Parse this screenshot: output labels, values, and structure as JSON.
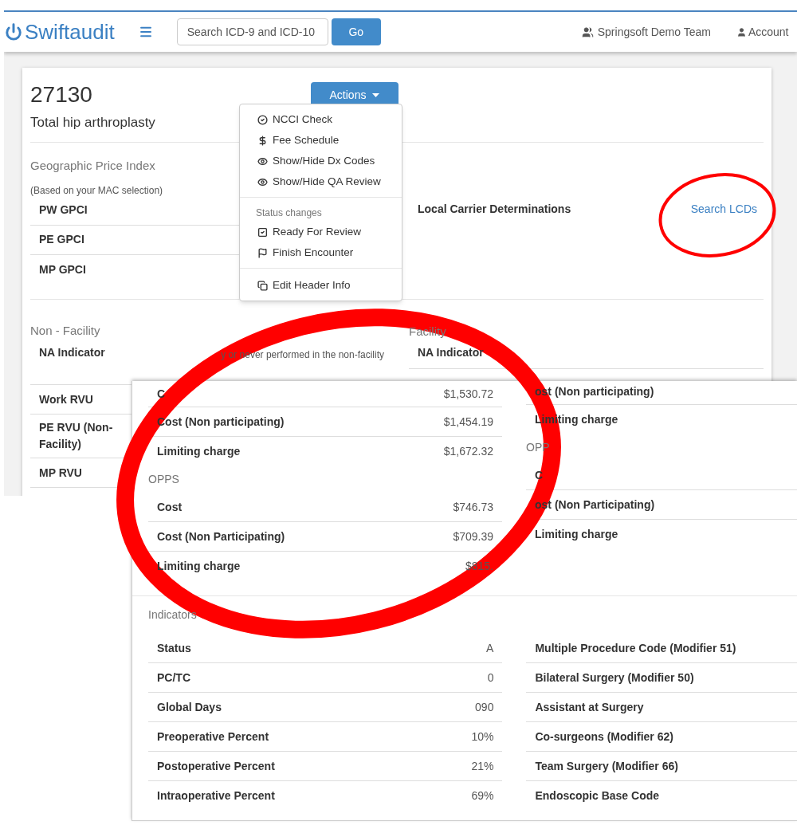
{
  "navbar": {
    "brand": "Swiftaudit",
    "search": {
      "placeholder": "Search ICD-9 and ICD-10"
    },
    "go_button": "Go",
    "team": "Springsoft Demo Team",
    "account": "Account"
  },
  "code": {
    "number": "27130",
    "description": "Total hip arthroplasty"
  },
  "actions": {
    "label": "Actions",
    "expanded": true,
    "groups": [
      {
        "items": [
          "NCCI Check",
          "Fee Schedule",
          "Show/Hide Dx Codes",
          "Show/Hide QA Review"
        ]
      },
      {
        "header": "Status changes",
        "items": [
          "Ready For Review",
          "Finish Encounter"
        ]
      },
      {
        "items": [
          "Edit Header Info"
        ]
      }
    ]
  },
  "gpci": {
    "title": "Geographic Price Index",
    "note": "(Based on your MAC selection)",
    "rows": [
      "PW GPCI",
      "PE GPCI",
      "MP GPCI"
    ]
  },
  "lcd": {
    "label": "Local Carrier Determinations",
    "link": "Search LCDs"
  },
  "non_facility": {
    "title": "Non - Facility",
    "rows": [
      {
        "label": "NA Indicator",
        "value": "y or never performed in the non-facility"
      },
      {
        "label": "Work RVU"
      },
      {
        "label": "PE RVU (Non-Facility)"
      },
      {
        "label": "MP RVU"
      }
    ]
  },
  "facility": {
    "title": "Facility",
    "rows": [
      {
        "label": "NA Indicator"
      }
    ]
  },
  "fees": {
    "left": [
      {
        "rows": [
          {
            "label": "C",
            "value": "$1,530.72"
          },
          {
            "label": "Cost (Non participating)",
            "value": "$1,454.19"
          },
          {
            "label": "Limiting charge",
            "value": "$1,672.32"
          }
        ]
      },
      {
        "title": "OPPS",
        "rows": [
          {
            "label": "Cost",
            "value": "$746.73"
          },
          {
            "label": "Cost (Non Participating)",
            "value": "$709.39"
          },
          {
            "label": "Limiting charge",
            "value": "$815."
          }
        ]
      }
    ],
    "right": [
      {
        "rows": [
          {
            "label": "ost (Non participating)"
          },
          {
            "label": "Limiting charge"
          }
        ]
      },
      {
        "title": "OPP",
        "rows": [
          {
            "label": "C"
          },
          {
            "label": "ost (Non Participating)"
          },
          {
            "label": "Limiting charge"
          }
        ]
      }
    ]
  },
  "indicators": {
    "title": "Indicators",
    "left": [
      {
        "label": "Status",
        "value": "A"
      },
      {
        "label": "PC/TC",
        "value": "0"
      },
      {
        "label": "Global Days",
        "value": "090"
      },
      {
        "label": "Preoperative Percent",
        "value": "10%"
      },
      {
        "label": "Postoperative Percent",
        "value": "21%"
      },
      {
        "label": "Intraoperative Percent",
        "value": "69%"
      }
    ],
    "right": [
      "Multiple Procedure Code (Modifier 51)",
      "Bilateral Surgery (Modifier 50)",
      "Assistant at Surgery",
      "Co-surgeons (Modifier 62)",
      "Team Surgery (Modifier 66)",
      "Endoscopic Base Code"
    ]
  }
}
